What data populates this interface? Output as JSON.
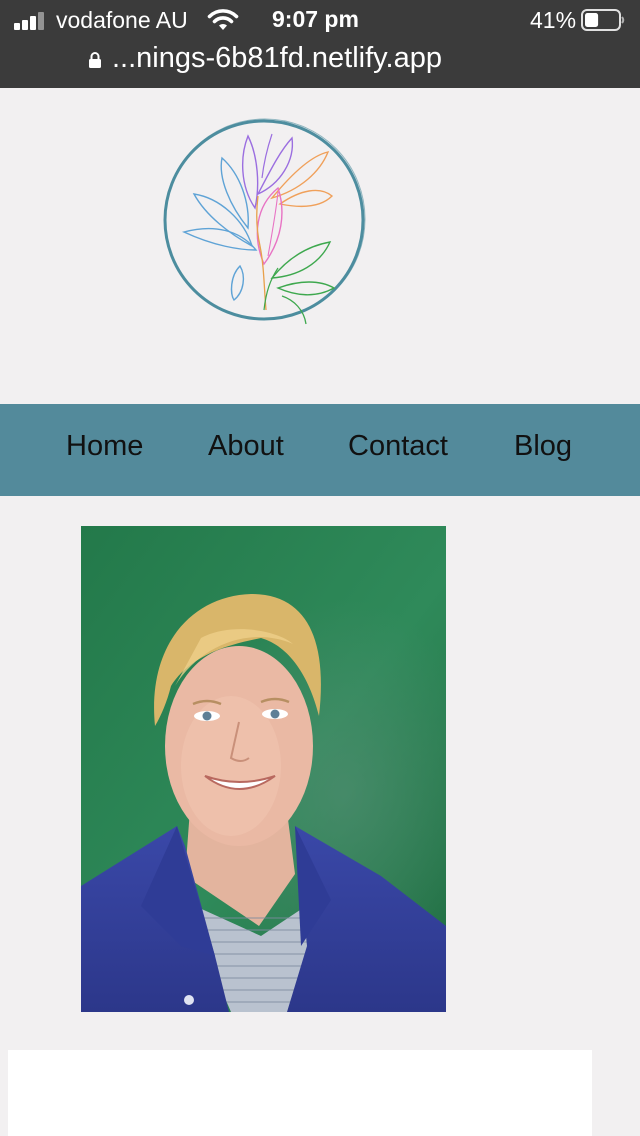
{
  "status_bar": {
    "carrier": "vodafone AU",
    "time": "9:07 pm",
    "battery_percent": "41%",
    "battery_level": 0.41
  },
  "browser": {
    "url": "...nings-6b81fd.netlify.app"
  },
  "nav": {
    "items": [
      {
        "label": "Home"
      },
      {
        "label": "About"
      },
      {
        "label": "Contact"
      },
      {
        "label": "Blog"
      }
    ]
  },
  "colors": {
    "nav_background": "#538a9b",
    "page_background": "#f2f0f1",
    "logo_ring": "#4d8d9f"
  },
  "icons": [
    "signal-icon",
    "wifi-icon",
    "battery-icon",
    "lock-icon"
  ]
}
